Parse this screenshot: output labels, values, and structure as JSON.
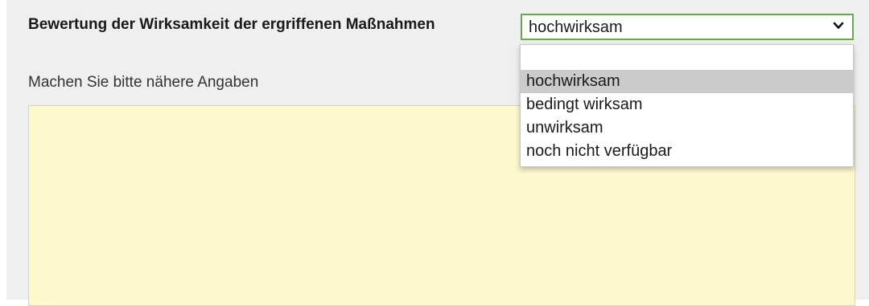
{
  "form": {
    "question_label": "Bewertung der Wirksamkeit der ergriffenen Maßnahmen",
    "details_label": "Machen Sie bitte nähere Angaben",
    "details_value": ""
  },
  "select": {
    "selected_value": "hochwirksam",
    "icon": "chevron-down-icon",
    "options": [
      {
        "label": ""
      },
      {
        "label": "hochwirksam",
        "selected": true
      },
      {
        "label": "bedingt wirksam"
      },
      {
        "label": "unwirksam"
      },
      {
        "label": "noch nicht verfügbar"
      }
    ]
  },
  "colors": {
    "select_border": "#6aa84f",
    "textarea_background": "#fdf8cd",
    "option_highlight": "#cbcbcb",
    "panel_background": "#efefef"
  }
}
